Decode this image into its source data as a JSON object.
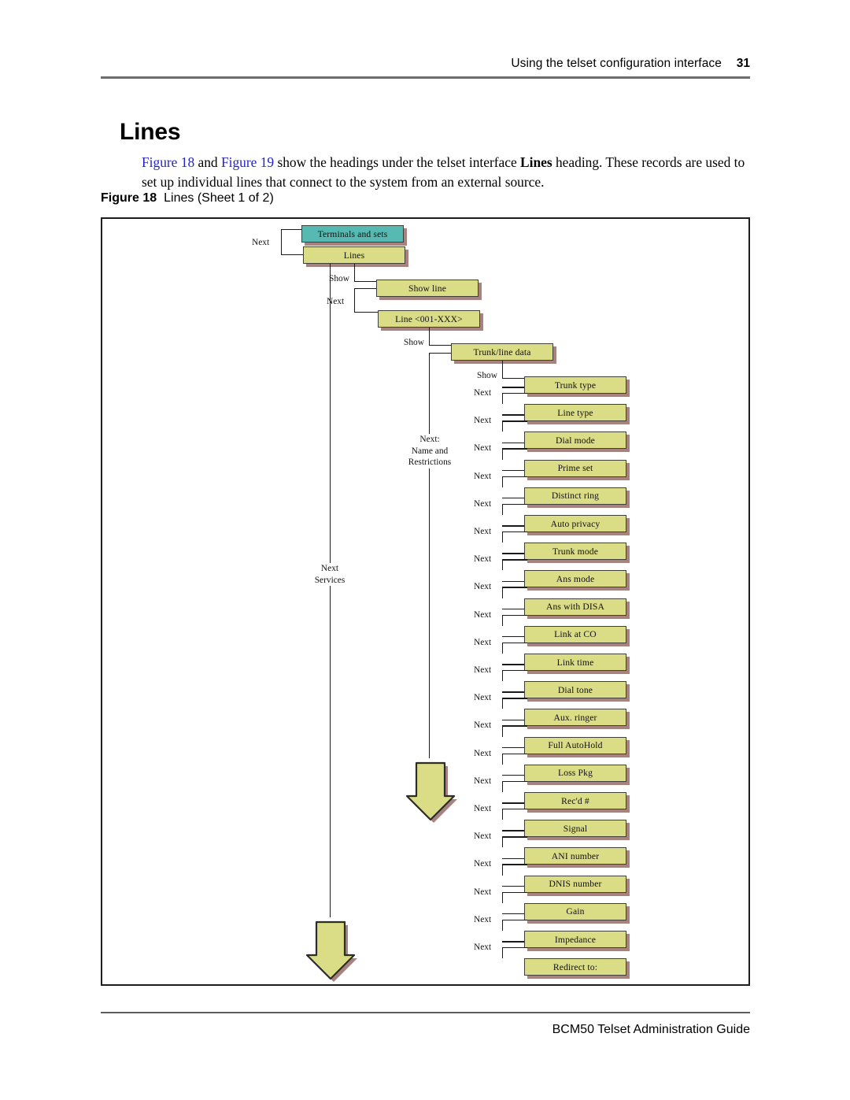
{
  "header": {
    "title": "Using the telset configuration interface",
    "page_number": "31"
  },
  "section": {
    "heading": "Lines",
    "paragraph_parts": {
      "xref1": "Figure 18",
      "mid1": " and ",
      "xref2": "Figure 19",
      "mid2": " show the headings under the telset interface ",
      "bold1": "Lines",
      "tail": " heading. These records are used to set up individual lines that connect to the system from an external source."
    }
  },
  "figure": {
    "caption_number": "Figure 18",
    "caption_text": "Lines (Sheet 1 of 2)",
    "colors": {
      "node_fill": "#dbdc86",
      "node_fill_highlight": "#56bab2",
      "node_border": "#3f3f3a",
      "node_shadow": "#a8827f",
      "connector": "#1a1a1a",
      "frame": "#1d1d1d"
    },
    "nodes": {
      "terminals_and_sets": "Terminals and sets",
      "lines": "Lines",
      "show_line": "Show line",
      "line_range": "Line <001-XXX>",
      "trunk_line_data": "Trunk/line data"
    },
    "trunk_line_data_items": [
      "Trunk type",
      "Line type",
      "Dial mode",
      "Prime set",
      "Distinct ring",
      "Auto privacy",
      "Trunk mode",
      "Ans mode",
      "Ans with DISA",
      "Link at CO",
      "Link time",
      "Dial tone",
      "Aux. ringer",
      "Full AutoHold",
      "Loss Pkg",
      "Rec'd #",
      "Signal",
      "ANI number",
      "DNIS number",
      "Gain",
      "Impedance",
      "Redirect to:"
    ],
    "edge_labels": {
      "next": "Next",
      "show": "Show",
      "next_terminals_to_lines": "Next",
      "show_lines_to_showline": "Show",
      "next_showline_to_linerange": "Next",
      "show_linerange_to_trunkdata": "Show",
      "show_trunkdata_to_trunktype": "Show",
      "next_name_restrictions": "Next:\nName and\nRestrictions",
      "next_name_restrictions_line1": "Next:",
      "next_name_restrictions_line2": "Name and",
      "next_name_restrictions_line3": "Restrictions",
      "next_services_line1": "Next",
      "next_services_line2": "Services"
    }
  },
  "footer": {
    "text": "BCM50 Telset Administration Guide"
  }
}
